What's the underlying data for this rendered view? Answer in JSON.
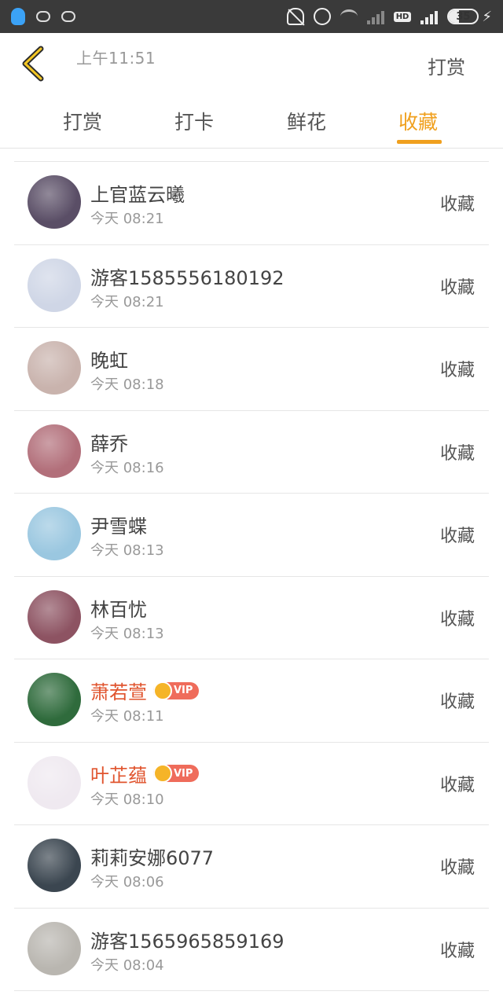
{
  "status_bar": {
    "time": "上午11:51",
    "battery_level": "35",
    "network_label": "HD"
  },
  "header": {
    "reward_link": "打赏"
  },
  "tabs": [
    {
      "label": "打赏",
      "active": false
    },
    {
      "label": "打卡",
      "active": false
    },
    {
      "label": "鲜花",
      "active": false
    },
    {
      "label": "收藏",
      "active": true
    }
  ],
  "list": [
    {
      "name": "上官蓝云曦",
      "time": "今天 08:21",
      "action": "收藏",
      "vip": false,
      "avatar_color": "#5a4e66"
    },
    {
      "name": "游客15855561801​92",
      "time": "今天 08:21",
      "action": "收藏",
      "vip": false,
      "avatar_color": "#cfd6e6"
    },
    {
      "name": "晚虹",
      "time": "今天 08:18",
      "action": "收藏",
      "vip": false,
      "avatar_color": "#c9b3ad"
    },
    {
      "name": "薛乔",
      "time": "今天 08:16",
      "action": "收藏",
      "vip": false,
      "avatar_color": "#b26f7a"
    },
    {
      "name": "尹雪蝶",
      "time": "今天 08:13",
      "action": "收藏",
      "vip": false,
      "avatar_color": "#9ac7e0"
    },
    {
      "name": "林百忧",
      "time": "今天 08:13",
      "action": "收藏",
      "vip": false,
      "avatar_color": "#8d5362"
    },
    {
      "name": "萧若萱",
      "time": "今天 08:11",
      "action": "收藏",
      "vip": true,
      "vip_label": "VIP",
      "avatar_color": "#2f6b3c"
    },
    {
      "name": "叶芷蕴",
      "time": "今天 08:10",
      "action": "收藏",
      "vip": true,
      "vip_label": "VIP",
      "avatar_color": "#efe9f0"
    },
    {
      "name": "莉莉安娜6077",
      "time": "今天 08:06",
      "action": "收藏",
      "vip": false,
      "avatar_color": "#3b4650"
    },
    {
      "name": "游客15659658591​69",
      "time": "今天 08:04",
      "action": "收藏",
      "vip": false,
      "avatar_color": "#b9b6b0"
    }
  ],
  "colors": {
    "accent": "#f0a01e",
    "vip_name": "#e0542e",
    "vip_badge": "#ef6c5b"
  }
}
